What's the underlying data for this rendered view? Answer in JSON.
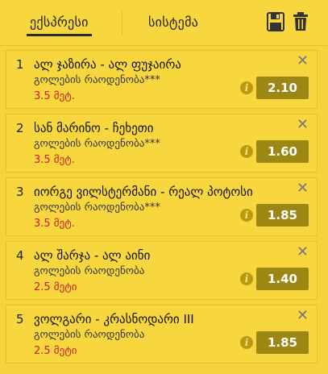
{
  "header": {
    "tabs": [
      {
        "label": "ექსპრესი",
        "active": true
      },
      {
        "label": "სისტემა",
        "active": false
      }
    ],
    "icons": [
      "save-icon",
      "trash-icon"
    ]
  },
  "bets": [
    {
      "index": "1",
      "teams": "ალ ჯაზირა - ალ ფუჯაირა",
      "market": "გოლების რაოდენობა***",
      "outcome": "3.5 მეტ.",
      "odds": "2.10"
    },
    {
      "index": "2",
      "teams": "სან მარინო - ჩეხეთი",
      "market": "გოლების რაოდენობა***",
      "outcome": "3.5 მეტ.",
      "odds": "1.60"
    },
    {
      "index": "3",
      "teams": "იორგე ვილსტერმანი - რეალ პოტოსი",
      "market": "გოლების რაოდენობა***",
      "outcome": "3.5 მეტ.",
      "odds": "1.85"
    },
    {
      "index": "4",
      "teams": "ალ შარჯა - ალ აინი",
      "market": "გოლების რაოდენობა",
      "outcome": "2.5 მეტი",
      "odds": "1.40"
    },
    {
      "index": "5",
      "teams": "ვოლგარი - კრასნოდარი III",
      "market": "გოლების რაოდენობა",
      "outcome": "2.5 მეტი",
      "odds": "1.85"
    }
  ],
  "colors": {
    "panel_bg": "#f5d33c",
    "card_bg": "#f7d63e",
    "odds_bg": "#9c8715",
    "outcome_text": "#c82020"
  }
}
